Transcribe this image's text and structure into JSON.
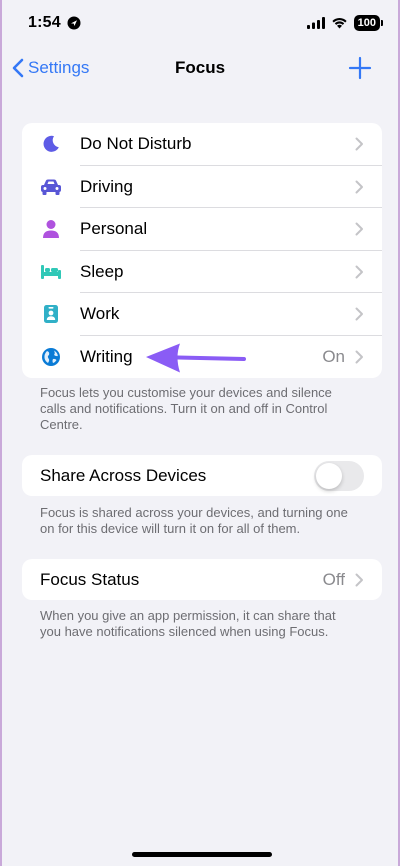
{
  "status_bar": {
    "time": "1:54",
    "battery": "100"
  },
  "nav": {
    "back_label": "Settings",
    "title": "Focus"
  },
  "focus_modes": [
    {
      "label": "Do Not Disturb",
      "icon": "moon-icon",
      "color": "#5e5ce6",
      "value": ""
    },
    {
      "label": "Driving",
      "icon": "car-icon",
      "color": "#5856d6",
      "value": ""
    },
    {
      "label": "Personal",
      "icon": "person-icon",
      "color": "#af52de",
      "value": ""
    },
    {
      "label": "Sleep",
      "icon": "bed-icon",
      "color": "#30c8b7",
      "value": ""
    },
    {
      "label": "Work",
      "icon": "badge-icon",
      "color": "#30b0c7",
      "value": ""
    },
    {
      "label": "Writing",
      "icon": "globe-icon",
      "color": "#0a7bd6",
      "value": "On"
    }
  ],
  "focus_modes_footnote": "Focus lets you customise your devices and silence calls and notifications. Turn it on and off in Control Centre.",
  "share": {
    "label": "Share Across Devices",
    "enabled": false,
    "footnote": "Focus is shared across your devices, and turning one on for this device will turn it on for all of them."
  },
  "focus_status": {
    "label": "Focus Status",
    "value": "Off",
    "footnote": "When you give an app permission, it can share that you have notifications silenced when using Focus."
  },
  "colors": {
    "accent": "#3478f6",
    "annotation_arrow": "#8a5cf5"
  }
}
